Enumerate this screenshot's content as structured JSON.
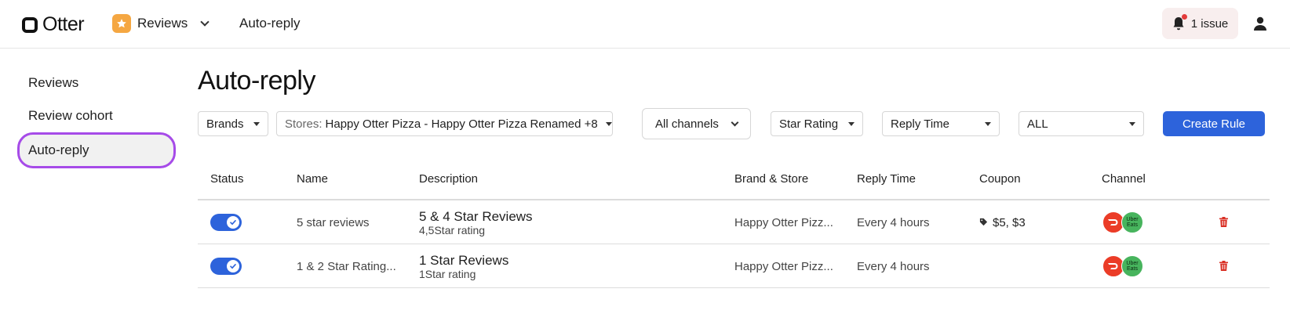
{
  "header": {
    "logo_text": "Otter",
    "app_name": "Reviews",
    "page_crumb": "Auto-reply",
    "issue_label": "1 issue"
  },
  "sidebar": {
    "items": [
      {
        "label": "Reviews"
      },
      {
        "label": "Review cohort"
      },
      {
        "label": "Auto-reply"
      }
    ]
  },
  "main": {
    "title": "Auto-reply",
    "filters": {
      "brands": "Brands",
      "stores_prefix": "Stores:",
      "stores_value": "Happy Otter Pizza - Happy Otter Pizza Renamed +8",
      "channels": "All channels",
      "star_rating": "Star Rating",
      "reply_time": "Reply Time",
      "all": "ALL"
    },
    "create_rule": "Create Rule"
  },
  "table": {
    "columns": [
      "Status",
      "Name",
      "Description",
      "Brand & Store",
      "Reply Time",
      "Coupon",
      "Channel"
    ],
    "rows": [
      {
        "name": "5 star reviews",
        "desc_title": "5 & 4 Star Reviews",
        "desc_sub": "4,5Star rating",
        "brand_store": "Happy Otter Pizz...",
        "reply_time": "Every 4 hours",
        "coupon": "$5, $3"
      },
      {
        "name": "1 & 2 Star Rating...",
        "desc_title": "1 Star Reviews",
        "desc_sub": "1Star rating",
        "brand_store": "Happy Otter Pizz...",
        "reply_time": "Every 4 hours",
        "coupon": ""
      }
    ],
    "channel_badge_text": "Uber Eats"
  },
  "colors": {
    "accent": "#2d63db",
    "active_outline": "#a64be8",
    "doordash": "#eb3c27",
    "ubereats": "#47b45d",
    "danger": "#d93025"
  },
  "icons": [
    "otter-logo-icon",
    "star-icon",
    "chevron-down-icon",
    "bell-icon",
    "user-icon",
    "check-icon",
    "tag-icon",
    "doordash-icon",
    "ubereats-icon",
    "trash-icon"
  ]
}
